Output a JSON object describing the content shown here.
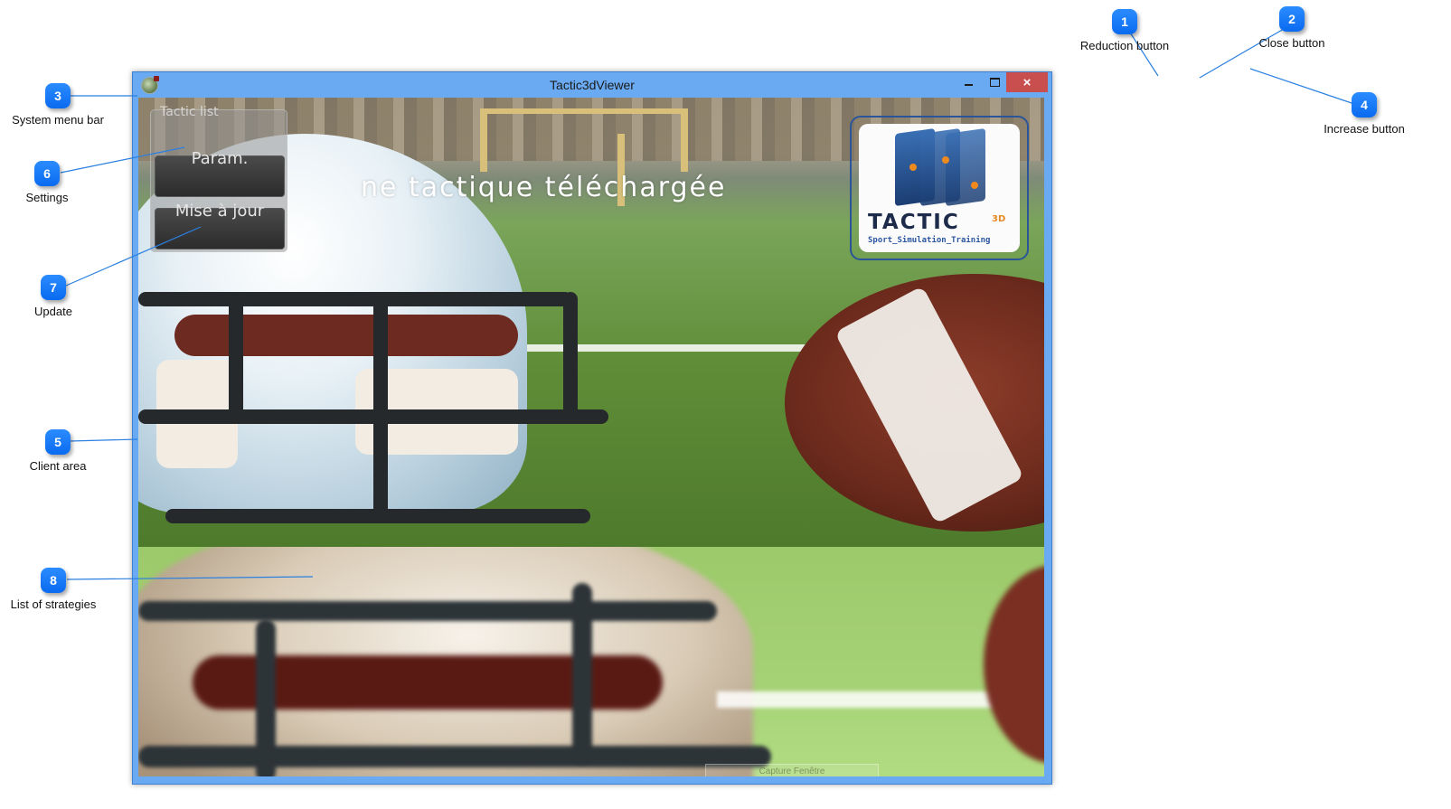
{
  "window": {
    "title": "Tactic3dViewer",
    "controls": {
      "minimize": "minimize",
      "maximize": "maximize",
      "close": "×"
    }
  },
  "client": {
    "status_text": "ne tactique téléchargée",
    "panel": {
      "title": "Tactic list",
      "param_label": "Param.",
      "update_label": "Mise à jour"
    },
    "logo": {
      "word": "TACTIC",
      "suffix": "3D",
      "tagline": "Sport_Simulation_Training"
    },
    "capture_label": "Capture Fenêtre"
  },
  "annotations": [
    {
      "number": "1",
      "label": "Reduction button"
    },
    {
      "number": "2",
      "label": "Close button"
    },
    {
      "number": "3",
      "label": "System menu bar"
    },
    {
      "number": "4",
      "label": "Increase button"
    },
    {
      "number": "5",
      "label": "Client area"
    },
    {
      "number": "6",
      "label": "Settings"
    },
    {
      "number": "7",
      "label": "Update"
    },
    {
      "number": "8",
      "label": "List of strategies"
    }
  ],
  "colors": {
    "titlebar": "#6aaaf3",
    "close_button": "#c94f4f",
    "callout": "#0a6af0",
    "leader_line": "#2a7fe0"
  }
}
